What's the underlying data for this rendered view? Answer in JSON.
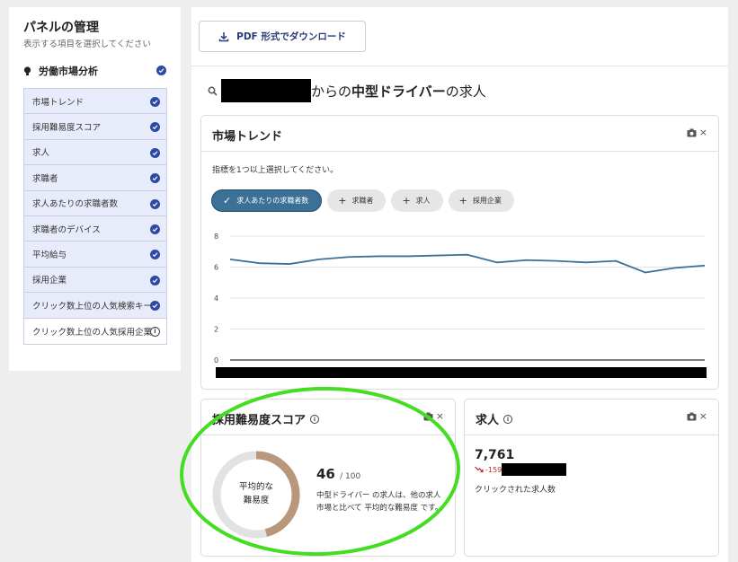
{
  "sidebar": {
    "title": "パネルの管理",
    "subtitle": "表示する項目を選択してください",
    "section": "労働市場分析",
    "items": [
      {
        "label": "市場トレンド",
        "checked": true
      },
      {
        "label": "採用難易度スコア",
        "checked": true
      },
      {
        "label": "求人",
        "checked": true
      },
      {
        "label": "求職者",
        "checked": true
      },
      {
        "label": "求人あたりの求職者数",
        "checked": true
      },
      {
        "label": "求職者のデバイス",
        "checked": true
      },
      {
        "label": "平均給与",
        "checked": true
      },
      {
        "label": "採用企業",
        "checked": true
      },
      {
        "label": "クリック数上位の人気検索キー",
        "checked": true
      },
      {
        "label": "クリック数上位の人気採用企業",
        "checked": false
      }
    ]
  },
  "toolbar": {
    "pdf_label": "PDF 形式でダウンロード"
  },
  "heading": {
    "from": "からの",
    "keyword": "中型ドライバー",
    "suffix": "の求人"
  },
  "trend": {
    "title": "市場トレンド",
    "close": "×",
    "hint": "指標を1つ以上選択してください。",
    "chips": [
      {
        "label": "求人あたりの求職者数",
        "icon": "✓",
        "active": true
      },
      {
        "label": "求職者",
        "icon": "+",
        "active": false
      },
      {
        "label": "求人",
        "icon": "+",
        "active": false
      },
      {
        "label": "採用企業",
        "icon": "+",
        "active": false
      }
    ]
  },
  "chart_data": {
    "type": "line",
    "ylim": [
      0,
      8
    ],
    "yticks": [
      "0",
      "2",
      "4",
      "6",
      "8"
    ],
    "series": [
      {
        "values": [
          6.5,
          6.25,
          6.2,
          6.5,
          6.65,
          6.7,
          6.7,
          6.75,
          6.8,
          6.3,
          6.45,
          6.4,
          6.3,
          6.4,
          5.65,
          5.95,
          6.1
        ],
        "color": "#3b7196"
      }
    ]
  },
  "score": {
    "title": "採用難易度スコア",
    "close": "×",
    "donut_line1": "平均的な",
    "donut_line2": "難易度",
    "value": "46",
    "max": "/ 100",
    "value_num": 46,
    "description": "中型ドライバー の求人は、他の求人市場と比べて 平均的な難易度 です。"
  },
  "jobs": {
    "title": "求人",
    "close": "×",
    "count": "7,761",
    "delta": "-159",
    "caption": "クリックされた求人数"
  },
  "colors": {
    "accent": "#3b7196",
    "check": "#2b4aa8",
    "donut": "#b8977a",
    "annotation": "#44dd22"
  }
}
